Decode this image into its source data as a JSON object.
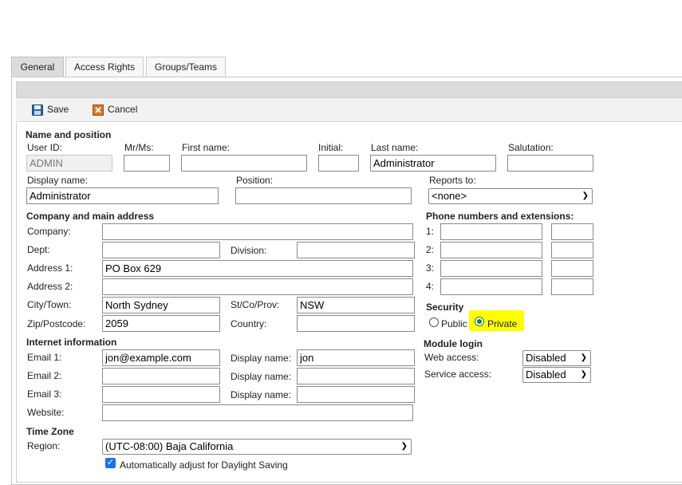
{
  "tabs": [
    "General",
    "Access Rights",
    "Groups/Teams"
  ],
  "toolbar": {
    "save_label": "Save",
    "cancel_label": "Cancel"
  },
  "name_section": {
    "title": "Name and position",
    "user_id_label": "User ID:",
    "user_id_value": "ADMIN",
    "mrms_label": "Mr/Ms:",
    "mrms_value": "",
    "first_name_label": "First name:",
    "first_name_value": "",
    "initial_label": "Initial:",
    "initial_value": "",
    "last_name_label": "Last name:",
    "last_name_value": "Administrator",
    "salutation_label": "Salutation:",
    "salutation_value": "",
    "display_name_label": "Display name:",
    "display_name_value": "Administrator",
    "position_label": "Position:",
    "position_value": "",
    "reports_to_label": "Reports to:",
    "reports_to_value": "<none>"
  },
  "company_section": {
    "title": "Company and main address",
    "company_label": "Company:",
    "company_value": "",
    "dept_label": "Dept:",
    "dept_value": "",
    "division_label": "Division:",
    "division_value": "",
    "address1_label": "Address 1:",
    "address1_value": "PO Box 629",
    "address2_label": "Address 2:",
    "address2_value": "",
    "city_label": "City/Town:",
    "city_value": "North Sydney",
    "state_label": "St/Co/Prov:",
    "state_value": "NSW",
    "zip_label": "Zip/Postcode:",
    "zip_value": "2059",
    "country_label": "Country:",
    "country_value": ""
  },
  "phone_section": {
    "title": "Phone numbers and extensions:",
    "rows": [
      {
        "label": "1:",
        "number": "",
        "ext": ""
      },
      {
        "label": "2:",
        "number": "",
        "ext": ""
      },
      {
        "label": "3:",
        "number": "",
        "ext": ""
      },
      {
        "label": "4:",
        "number": "",
        "ext": ""
      }
    ]
  },
  "security": {
    "title": "Security",
    "public_label": "Public",
    "private_label": "Private",
    "selected": "Private",
    "highlight_color": "#ffff00"
  },
  "module_login": {
    "title": "Module login",
    "web_access_label": "Web access:",
    "web_access_value": "Disabled",
    "service_access_label": "Service access:",
    "service_access_value": "Disabled"
  },
  "internet_section": {
    "title": "Internet information",
    "emails": [
      {
        "label": "Email 1:",
        "value": "jon@example.com",
        "display_label": "Display name:",
        "display_value": "jon"
      },
      {
        "label": "Email 2:",
        "value": "",
        "display_label": "Display name:",
        "display_value": ""
      },
      {
        "label": "Email 3:",
        "value": "",
        "display_label": "Display name:",
        "display_value": ""
      }
    ],
    "website_label": "Website:",
    "website_value": ""
  },
  "timezone": {
    "title": "Time Zone",
    "region_label": "Region:",
    "region_value": "(UTC-08:00) Baja California",
    "dst_label": "Automatically adjust for Daylight Saving",
    "dst_checked": true
  },
  "colors": {
    "checkbox": "#1a73e8",
    "radio_selected": "#1a7f37"
  }
}
